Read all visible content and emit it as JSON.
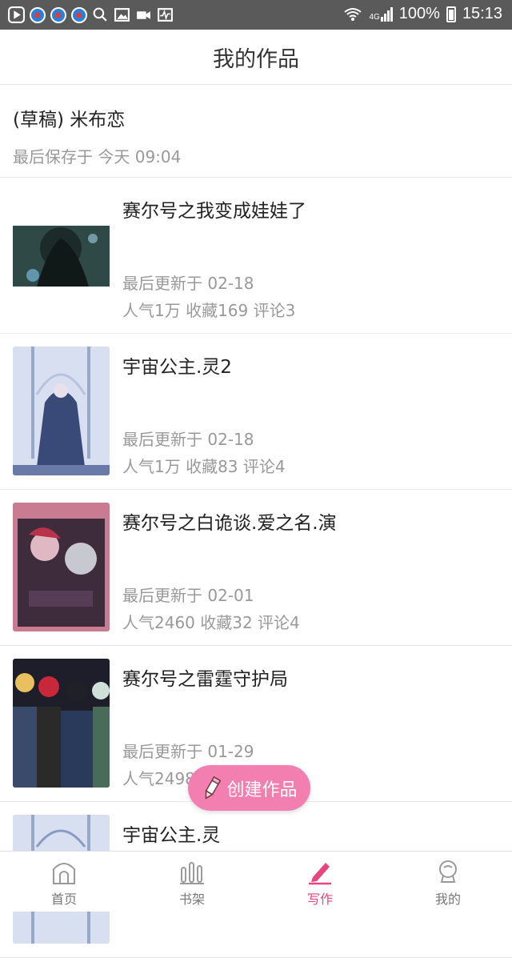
{
  "status_bar": {
    "battery": "100%",
    "time": "15:13",
    "network": "4G"
  },
  "header": {
    "title": "我的作品"
  },
  "draft": {
    "title": "(草稿) 米布恋",
    "saved": "最后保存于 今天 09:04"
  },
  "works": [
    {
      "title": "赛尔号之我变成娃娃了",
      "updated": "最后更新于 02-18",
      "stats": "人气1万 收藏169 评论3",
      "cover_color": "#2f4a46"
    },
    {
      "title": "宇宙公主.灵2",
      "updated": "最后更新于 02-18",
      "stats": "人气1万 收藏83 评论4",
      "cover_color": "#4a5a8a"
    },
    {
      "title": "赛尔号之白诡谈.爱之名.演",
      "updated": "最后更新于 02-01",
      "stats": "人气2460 收藏32 评论4",
      "cover_color": "#a8566f"
    },
    {
      "title": "赛尔号之雷霆守护局",
      "updated": "最后更新于 01-29",
      "stats": "人气2498 收藏32 评论4",
      "cover_color": "#3a3a48"
    },
    {
      "title": "宇宙公主.灵",
      "updated": "",
      "stats": "",
      "cover_color": "#4a5a8a"
    }
  ],
  "create_button": {
    "label": "创建作品"
  },
  "bottom_nav": [
    {
      "label": "首页",
      "icon": "home-icon",
      "active": false
    },
    {
      "label": "书架",
      "icon": "bookshelf-icon",
      "active": false
    },
    {
      "label": "写作",
      "icon": "pencil-icon",
      "active": true
    },
    {
      "label": "我的",
      "icon": "profile-icon",
      "active": false
    }
  ],
  "colors": {
    "accent": "#e8457e",
    "fab": "#f37fb1"
  }
}
